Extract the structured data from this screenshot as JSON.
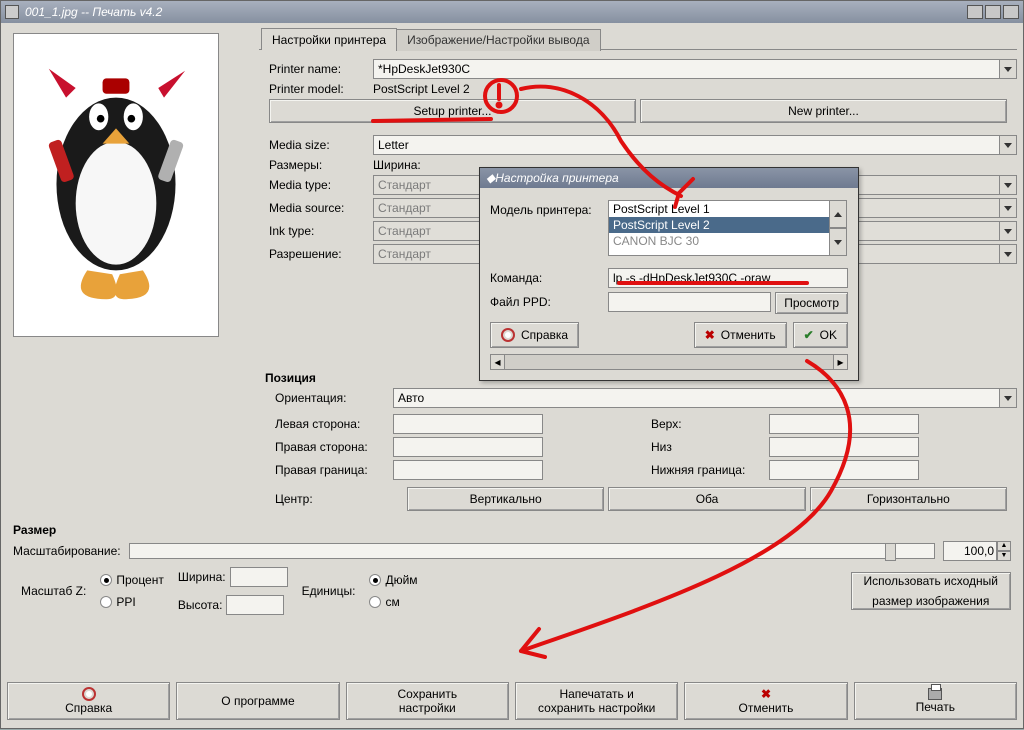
{
  "window": {
    "title": "001_1.jpg -- Печать v4.2"
  },
  "tabs": {
    "settings": "Настройки принтера",
    "output": "Изображение/Настройки вывода"
  },
  "printer": {
    "name_lbl": "Printer name:",
    "name": "*HpDeskJet930C",
    "model_lbl": "Printer model:",
    "model": "PostScript Level 2",
    "setup_btn": "Setup printer...",
    "new_btn": "New printer...",
    "media_size_lbl": "Media size:",
    "media_size": "Letter",
    "dims_lbl": "Размеры:",
    "width_lbl": "Ширина:",
    "media_type_lbl": "Media type:",
    "media_type": "Стандарт",
    "media_source_lbl": "Media source:",
    "media_source": "Стандарт",
    "ink_type_lbl": "Ink type:",
    "ink_type": "Стандарт",
    "resolution_lbl": "Разрешение:",
    "resolution": "Стандарт"
  },
  "position": {
    "heading": "Позиция",
    "orient_lbl": "Ориентация:",
    "orient": "Авто",
    "left_lbl": "Левая сторона:",
    "top_lbl": "Верх:",
    "right_lbl": "Правая сторона:",
    "bottom_lbl": "Низ",
    "rightb_lbl": "Правая граница:",
    "bottomb_lbl": "Нижняя граница:",
    "center_lbl": "Центр:",
    "vert": "Вертикально",
    "both": "Оба",
    "horiz": "Горизонтально"
  },
  "size": {
    "heading": "Размер",
    "scale_lbl": "Масштабирование:",
    "scale_val": "100,0",
    "scalez_lbl": "Масштаб Z:",
    "percent": "Процент",
    "ppi": "PPI",
    "width_lbl": "Ширина:",
    "height_lbl": "Высота:",
    "units_lbl": "Единицы:",
    "inch": "Дюйм",
    "cm": "см",
    "orig_btn_l1": "Использовать исходный",
    "orig_btn_l2": "размер изображения"
  },
  "bottom": {
    "help": "Справка",
    "about": "О программе",
    "save_l1": "Сохранить",
    "save_l2": "настройки",
    "printsave_l1": "Напечатать и",
    "printsave_l2": "сохранить настройки",
    "cancel": "Отменить",
    "print": "Печать"
  },
  "dialog": {
    "title": "Настройка принтера",
    "model_lbl": "Модель принтера:",
    "models": [
      "PostScript Level 1",
      "PostScript Level 2",
      "CANON BJC 30"
    ],
    "cmd_lbl": "Команда:",
    "cmd": "lp -s -dHpDeskJet930C -oraw",
    "ppd_lbl": "Файл PPD:",
    "browse": "Просмотр",
    "help": "Справка",
    "cancel": "Отменить",
    "ok": "OK"
  }
}
